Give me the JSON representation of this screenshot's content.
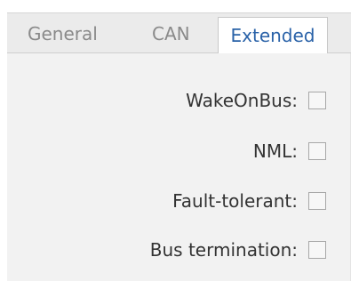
{
  "tabs": [
    {
      "label": "General",
      "active": false
    },
    {
      "label": "CAN",
      "active": false
    },
    {
      "label": "Extended",
      "active": true
    }
  ],
  "fields": [
    {
      "label": "WakeOnBus:",
      "checked": false
    },
    {
      "label": "NML:",
      "checked": false
    },
    {
      "label": "Fault-tolerant:",
      "checked": false
    },
    {
      "label": "Bus termination:",
      "checked": false
    }
  ],
  "colors": {
    "active_tab_text": "#2a62a8",
    "inactive_tab_text": "#8a8a8a",
    "panel_background": "#f2f2f2",
    "tabstrip_background": "#ebebeb"
  }
}
